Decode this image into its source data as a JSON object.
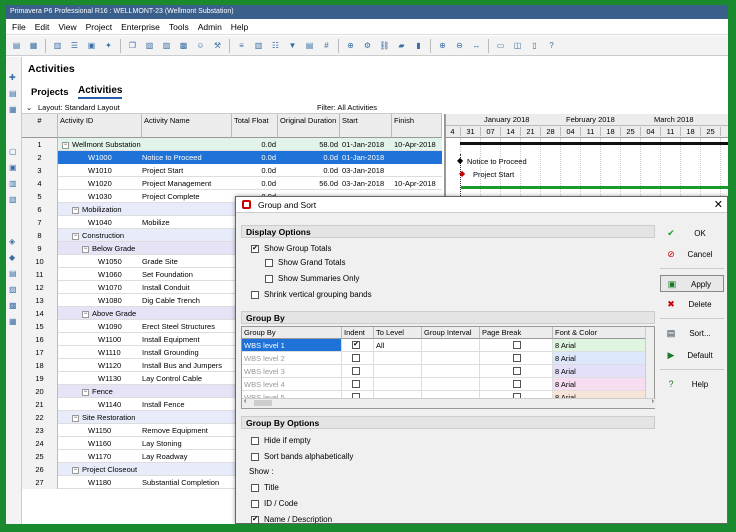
{
  "window": {
    "title": "Primavera P6 Professional R16 : WELLMONT-23 (Wellmont Substation)"
  },
  "menu": [
    "File",
    "Edit",
    "View",
    "Project",
    "Enterprise",
    "Tools",
    "Admin",
    "Help"
  ],
  "header": {
    "title": "Activities",
    "tabs": [
      "Projects",
      "Activities"
    ]
  },
  "layout_bar": {
    "layout": "Layout: Standard Layout",
    "filter": "Filter: All Activities"
  },
  "grid": {
    "columns": [
      "#",
      "Activity ID",
      "Activity Name",
      "Total Float",
      "Original Duration",
      "Start",
      "Finish"
    ],
    "rows": [
      {
        "n": "1",
        "id": "Wellmont Substation",
        "name": "",
        "tf": "0.0d",
        "od": "58.0d",
        "start": "01-Jan-2018",
        "finish": "10-Apr-2018",
        "band": 0,
        "indent": 0,
        "group": true
      },
      {
        "n": "2",
        "id": "W1000",
        "name": "Notice to Proceed",
        "tf": "0.0d",
        "od": "0.0d",
        "start": "01-Jan-2018",
        "finish": "",
        "band": -1,
        "indent": 0,
        "selected": true
      },
      {
        "n": "3",
        "id": "W1010",
        "name": "Project Start",
        "tf": "0.0d",
        "od": "0.0d",
        "start": "03-Jan-2018",
        "finish": "",
        "band": -1,
        "indent": 0
      },
      {
        "n": "4",
        "id": "W1020",
        "name": "Project Management",
        "tf": "0.0d",
        "od": "56.0d",
        "start": "03-Jan-2018",
        "finish": "10-Apr-2018",
        "band": -1,
        "indent": 0
      },
      {
        "n": "5",
        "id": "W1030",
        "name": "Project Complete",
        "tf": "0.0d",
        "od": "",
        "start": "",
        "finish": "",
        "band": -1,
        "indent": 0
      },
      {
        "n": "6",
        "id": "Mobilization",
        "name": "",
        "tf": "",
        "od": "",
        "start": "",
        "finish": "",
        "band": 1,
        "indent": 1,
        "group": true
      },
      {
        "n": "7",
        "id": "W1040",
        "name": "Mobilize",
        "tf": "",
        "od": "",
        "start": "",
        "finish": "",
        "band": -1,
        "indent": 1
      },
      {
        "n": "8",
        "id": "Construction",
        "name": "",
        "tf": "",
        "od": "",
        "start": "",
        "finish": "",
        "band": 1,
        "indent": 1,
        "group": true
      },
      {
        "n": "9",
        "id": "Below Grade",
        "name": "",
        "tf": "",
        "od": "",
        "start": "",
        "finish": "",
        "band": 2,
        "indent": 2,
        "group": true
      },
      {
        "n": "10",
        "id": "W1050",
        "name": "Grade Site",
        "tf": "",
        "od": "",
        "start": "",
        "finish": "",
        "band": -1,
        "indent": 2
      },
      {
        "n": "11",
        "id": "W1060",
        "name": "Set Foundation",
        "tf": "",
        "od": "",
        "start": "",
        "finish": "",
        "band": -1,
        "indent": 2
      },
      {
        "n": "12",
        "id": "W1070",
        "name": "Install Conduit",
        "tf": "",
        "od": "",
        "start": "",
        "finish": "",
        "band": -1,
        "indent": 2
      },
      {
        "n": "13",
        "id": "W1080",
        "name": "Dig Cable Trench",
        "tf": "",
        "od": "",
        "start": "",
        "finish": "",
        "band": -1,
        "indent": 2
      },
      {
        "n": "14",
        "id": "Above Grade",
        "name": "",
        "tf": "",
        "od": "",
        "start": "",
        "finish": "",
        "band": 2,
        "indent": 2,
        "group": true
      },
      {
        "n": "15",
        "id": "W1090",
        "name": "Erect Steel Structures",
        "tf": "",
        "od": "",
        "start": "",
        "finish": "",
        "band": -1,
        "indent": 2
      },
      {
        "n": "16",
        "id": "W1100",
        "name": "Install Equipment",
        "tf": "",
        "od": "",
        "start": "",
        "finish": "",
        "band": -1,
        "indent": 2
      },
      {
        "n": "17",
        "id": "W1110",
        "name": "Install Grounding",
        "tf": "",
        "od": "",
        "start": "",
        "finish": "",
        "band": -1,
        "indent": 2
      },
      {
        "n": "18",
        "id": "W1120",
        "name": "Install Bus and Jumpers",
        "tf": "",
        "od": "",
        "start": "",
        "finish": "",
        "band": -1,
        "indent": 2
      },
      {
        "n": "19",
        "id": "W1130",
        "name": "Lay Control Cable",
        "tf": "",
        "od": "",
        "start": "",
        "finish": "",
        "band": -1,
        "indent": 2
      },
      {
        "n": "20",
        "id": "Fence",
        "name": "",
        "tf": "",
        "od": "",
        "start": "",
        "finish": "",
        "band": 2,
        "indent": 2,
        "group": true
      },
      {
        "n": "21",
        "id": "W1140",
        "name": "Install Fence",
        "tf": "",
        "od": "",
        "start": "",
        "finish": "",
        "band": -1,
        "indent": 2
      },
      {
        "n": "22",
        "id": "Site Restoration",
        "name": "",
        "tf": "",
        "od": "",
        "start": "",
        "finish": "",
        "band": 1,
        "indent": 1,
        "group": true
      },
      {
        "n": "23",
        "id": "W1150",
        "name": "Remove Equipment",
        "tf": "",
        "od": "",
        "start": "",
        "finish": "",
        "band": -1,
        "indent": 1
      },
      {
        "n": "24",
        "id": "W1160",
        "name": "Lay Stoning",
        "tf": "",
        "od": "",
        "start": "",
        "finish": "",
        "band": -1,
        "indent": 1
      },
      {
        "n": "25",
        "id": "W1170",
        "name": "Lay Roadway",
        "tf": "",
        "od": "",
        "start": "",
        "finish": "",
        "band": -1,
        "indent": 1
      },
      {
        "n": "26",
        "id": "Project Closeout",
        "name": "",
        "tf": "",
        "od": "",
        "start": "",
        "finish": "",
        "band": 1,
        "indent": 1,
        "group": true
      },
      {
        "n": "27",
        "id": "W1180",
        "name": "Substantial Completion",
        "tf": "",
        "od": "",
        "start": "",
        "finish": "",
        "band": -1,
        "indent": 1
      }
    ]
  },
  "gantt": {
    "months": [
      "January 2018",
      "February 2018",
      "March 2018"
    ],
    "days": [
      "4",
      "31",
      "07",
      "14",
      "21",
      "28",
      "04",
      "11",
      "18",
      "25",
      "04",
      "11",
      "18",
      "25",
      "0"
    ],
    "bar_labels": [
      "Notice to Proceed",
      "Project Start"
    ]
  },
  "dialog": {
    "title": "Group and Sort",
    "display_options": {
      "heading": "Display Options",
      "items": [
        {
          "label": "Show Group Totals",
          "checked": true
        },
        {
          "label": "Show Grand Totals",
          "checked": false
        },
        {
          "label": "Show Summaries Only",
          "checked": false
        },
        {
          "label": "Shrink vertical grouping bands",
          "checked": false
        }
      ]
    },
    "group_by": {
      "heading": "Group By",
      "columns": [
        "Group By",
        "Indent",
        "To Level",
        "Group Interval",
        "Page Break",
        "Font & Color"
      ],
      "rows": [
        {
          "group": "WBS level 1",
          "indent": true,
          "level": "All",
          "interval": "",
          "page_break": false,
          "font": "8 Arial",
          "color": "#dff5df"
        },
        {
          "group": "WBS level 2",
          "indent": false,
          "level": "",
          "interval": "",
          "page_break": false,
          "font": "8 Arial",
          "color": "#dde7fb"
        },
        {
          "group": "WBS level 3",
          "indent": false,
          "level": "",
          "interval": "",
          "page_break": false,
          "font": "8 Arial",
          "color": "#e4e0fa"
        },
        {
          "group": "WBS level 4",
          "indent": false,
          "level": "",
          "interval": "",
          "page_break": false,
          "font": "8 Arial",
          "color": "#f7ddf0"
        },
        {
          "group": "WBS level 5",
          "indent": false,
          "level": "",
          "interval": "",
          "page_break": false,
          "font": "8 Arial",
          "color": "#f7e4d8"
        }
      ]
    },
    "group_by_options": {
      "heading": "Group By Options",
      "items": [
        {
          "label": "Hide if empty",
          "checked": false
        },
        {
          "label": "Sort bands alphabetically",
          "checked": false
        }
      ],
      "show_label": "Show :",
      "show_items": [
        {
          "label": "Title",
          "checked": false
        },
        {
          "label": "ID / Code",
          "checked": false
        },
        {
          "label": "Name / Description",
          "checked": true
        }
      ]
    },
    "buttons": {
      "ok": "OK",
      "cancel": "Cancel",
      "apply": "Apply",
      "delete": "Delete",
      "sort": "Sort...",
      "default": "Default",
      "help": "Help"
    }
  }
}
